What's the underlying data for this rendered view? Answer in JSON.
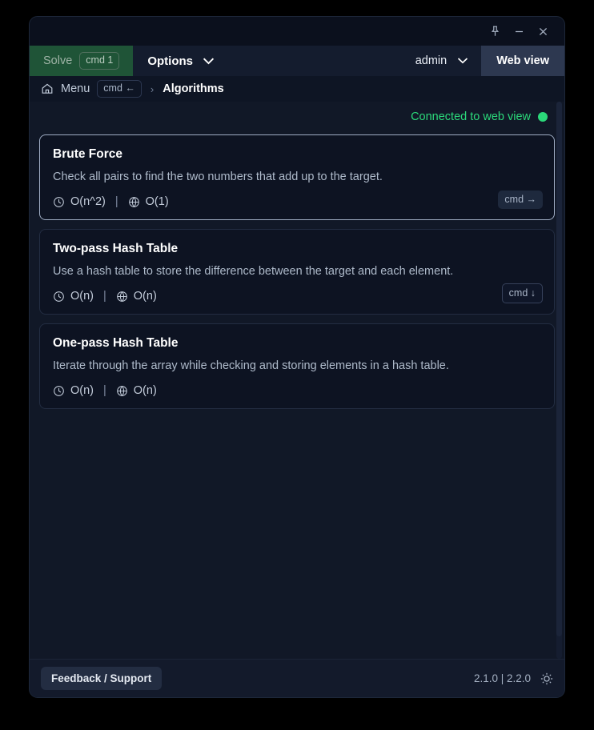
{
  "titlebar": {
    "pin_label": "pin-window",
    "minimize_label": "minimize",
    "close_label": "close"
  },
  "toolbar": {
    "solve_label": "Solve",
    "solve_shortcut": "cmd 1",
    "options_label": "Options",
    "account_label": "admin",
    "webview_tab_label": "Web view"
  },
  "breadcrumb": {
    "menu_label": "Menu",
    "menu_shortcut": "cmd ←",
    "separator": "›",
    "current_label": "Algorithms"
  },
  "status": {
    "text": "Connected to web view",
    "color": "#2bd97a"
  },
  "cards": [
    {
      "title": "Brute Force",
      "description": "Check all pairs to find the two numbers that add up to the target.",
      "time_complexity": "O(n^2)",
      "space_complexity": "O(1)",
      "separator": "|",
      "badge": "cmd →",
      "badge_style": "filled",
      "selected": true
    },
    {
      "title": "Two-pass Hash Table",
      "description": "Use a hash table to store the difference between the target and each element.",
      "time_complexity": "O(n)",
      "space_complexity": "O(n)",
      "separator": "|",
      "badge": "cmd ↓",
      "badge_style": "outlined",
      "selected": false
    },
    {
      "title": "One-pass Hash Table",
      "description": "Iterate through the array while checking and storing elements in a hash table.",
      "time_complexity": "O(n)",
      "space_complexity": "O(n)",
      "separator": "|",
      "badge": null,
      "badge_style": null,
      "selected": false
    }
  ],
  "footer": {
    "feedback_label": "Feedback / Support",
    "version": "2.1.0 | 2.2.0",
    "theme_toggle_label": "brightness"
  }
}
